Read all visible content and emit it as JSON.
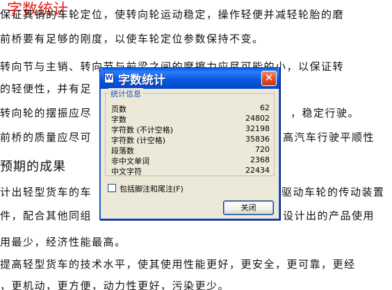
{
  "document": {
    "title": "字数统计",
    "lines": [
      "保证其销的车轮定位，使转向轮运动稳定，操作轻便并减轻轮胎的磨",
      "前桥要有足够的刚度，以使车轮定位参数保持不变。",
      "转向节与主销、转向节与前梁之间的摩擦力应尽可能的小，以保证转",
      "的轻便性，并有足",
      "转向轮的摆振应尽",
      "前桥的质量应尽可",
      "计出轻型货车的车",
      "件，配合其他同组",
      "用最少，经济性能最高。",
      "提高轻型货车的技术水平，使其使用性能更好，更安全，更可靠，更经",
      "，更机动，更方便，动力性更好，污染更少。"
    ],
    "right_fragments": [
      "，稳定行驶。",
      "高汽车行驶平顺性",
      "驱动车轮的传动装置",
      "设计出的产品使用"
    ],
    "heading": "预期的成果"
  },
  "dialog": {
    "title": "字数统计",
    "app_icon": "W",
    "close_glyph": "✕",
    "group_label": "统计信息",
    "stats": [
      {
        "label": "页数",
        "value": "62"
      },
      {
        "label": "字数",
        "value": "24802"
      },
      {
        "label": "字符数 (不计空格)",
        "value": "32198"
      },
      {
        "label": "字符数 (计空格)",
        "value": "35836"
      },
      {
        "label": "段落数",
        "value": "720"
      },
      {
        "label": "非中文单词",
        "value": "2368"
      },
      {
        "label": "中文字符",
        "value": "22434"
      }
    ],
    "checkbox_label": "包括脚注和尾注(F)",
    "checkbox_checked": false,
    "close_button": "关闭"
  },
  "colors": {
    "title_red": "#e0241b",
    "dialog_blue": "#0a5ae0",
    "dialog_bg": "#ece9d8",
    "close_red": "#dd4b1e"
  }
}
